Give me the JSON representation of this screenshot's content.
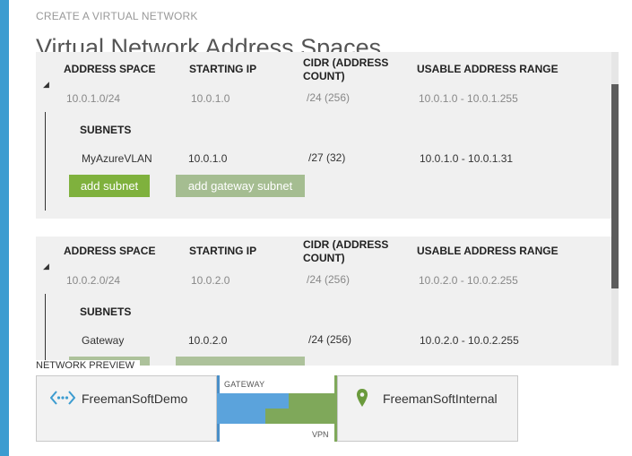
{
  "wizard": {
    "title": "CREATE A VIRTUAL NETWORK"
  },
  "page": {
    "title": "Virtual Network Address Spaces"
  },
  "columns": {
    "address_space": "ADDRESS SPACE",
    "starting_ip": "STARTING IP",
    "cidr_line1": "CIDR (ADDRESS",
    "cidr_line2": "COUNT)",
    "usable_range": "USABLE ADDRESS RANGE"
  },
  "address_spaces": [
    {
      "address_space": "10.0.1.0/24",
      "starting_ip": "10.0.1.0",
      "cidr": "/24 (256)",
      "usable_range": "10.0.1.0 - 10.0.1.255",
      "subnets_label": "SUBNETS",
      "subnets": [
        {
          "name": "MyAzureVLAN",
          "starting_ip": "10.0.1.0",
          "cidr": "/27 (32)",
          "usable_range": "10.0.1.0 - 10.0.1.31"
        }
      ],
      "add_subnet_label": "add subnet",
      "add_gateway_label": "add gateway subnet"
    },
    {
      "address_space": "10.0.2.0/24",
      "starting_ip": "10.0.2.0",
      "cidr": "/24 (256)",
      "usable_range": "10.0.2.0 - 10.0.2.255",
      "subnets_label": "SUBNETS",
      "subnets": [
        {
          "name": "Gateway",
          "starting_ip": "10.0.2.0",
          "cidr": "/24 (256)",
          "usable_range": "10.0.2.0 - 10.0.2.255"
        }
      ]
    }
  ],
  "preview": {
    "label": "NETWORK PREVIEW",
    "left_network": "FreemanSoftDemo",
    "right_network": "FreemanSoftInternal",
    "gateway_label": "GATEWAY",
    "vpn_label": "VPN"
  },
  "colors": {
    "accent_blue": "#3c9cd0",
    "button_green": "#7fb13d",
    "button_gray_green": "#a5bd91",
    "vnet_icon": "#3c9cd0",
    "location_icon": "#6a9a3c"
  },
  "icons": {
    "left_network": "vnet-icon",
    "right_network": "location-pin-icon",
    "expand": "caret-down-icon"
  }
}
